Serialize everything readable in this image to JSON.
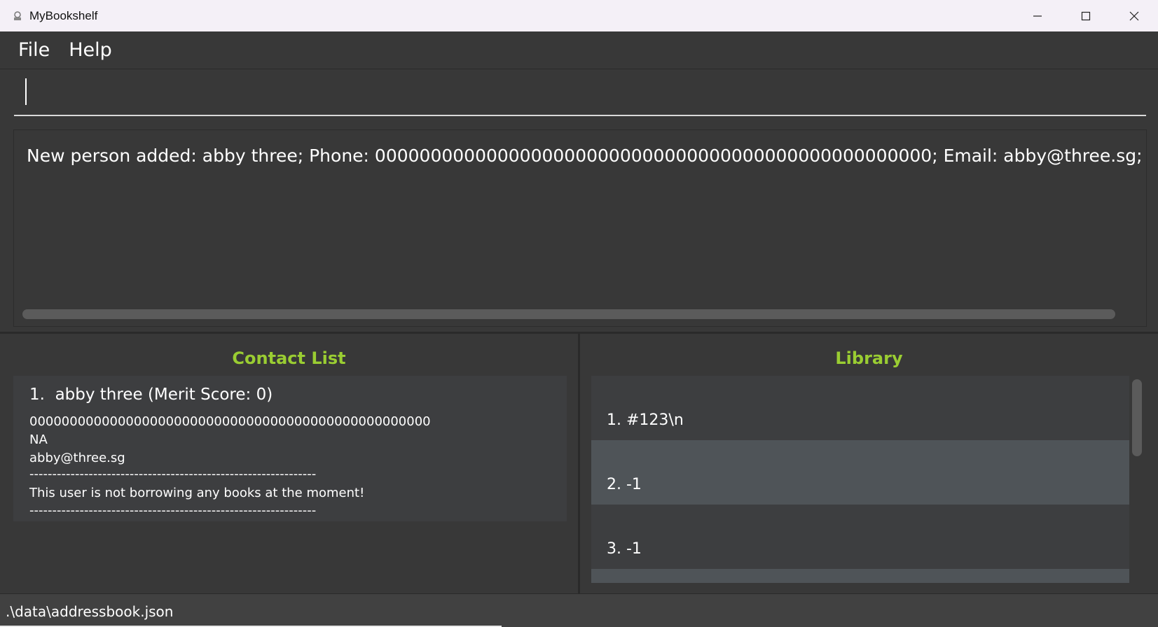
{
  "window": {
    "title": "MyBookshelf",
    "icon": "app-icon",
    "controls": [
      "minimize-icon",
      "maximize-icon",
      "close-icon"
    ]
  },
  "menu": {
    "items": [
      {
        "label": "File"
      },
      {
        "label": "Help"
      }
    ]
  },
  "command": {
    "value": ""
  },
  "result": {
    "text": "New person added: abby three; Phone: 00000000000000000000000000000000000000000000000000; Email: abby@three.sg; Address: NA; Tags: "
  },
  "contacts": {
    "title": "Contact List",
    "items": [
      {
        "index": "1.",
        "name": "abby three (Merit Score: 0)",
        "phone": "00000000000000000000000000000000000000000000000000",
        "address": "NA",
        "email": "abby@three.sg",
        "separator_top": "---------------------------------------------------------------",
        "borrow_status": " This user is not borrowing any books at the moment!",
        "separator_bottom": "---------------------------------------------------------------"
      }
    ]
  },
  "library": {
    "title": "Library",
    "items": [
      {
        "label": "1. #123\\n"
      },
      {
        "label": "2. -1"
      },
      {
        "label": "3. -1"
      }
    ]
  },
  "status": {
    "path": ".\\data\\addressbook.json"
  },
  "colors": {
    "background": "#383838",
    "accent_green": "#9acd32",
    "card": "#3d3e40",
    "selected_row": "#4f5458",
    "titlebar": "#f4f0f7"
  }
}
